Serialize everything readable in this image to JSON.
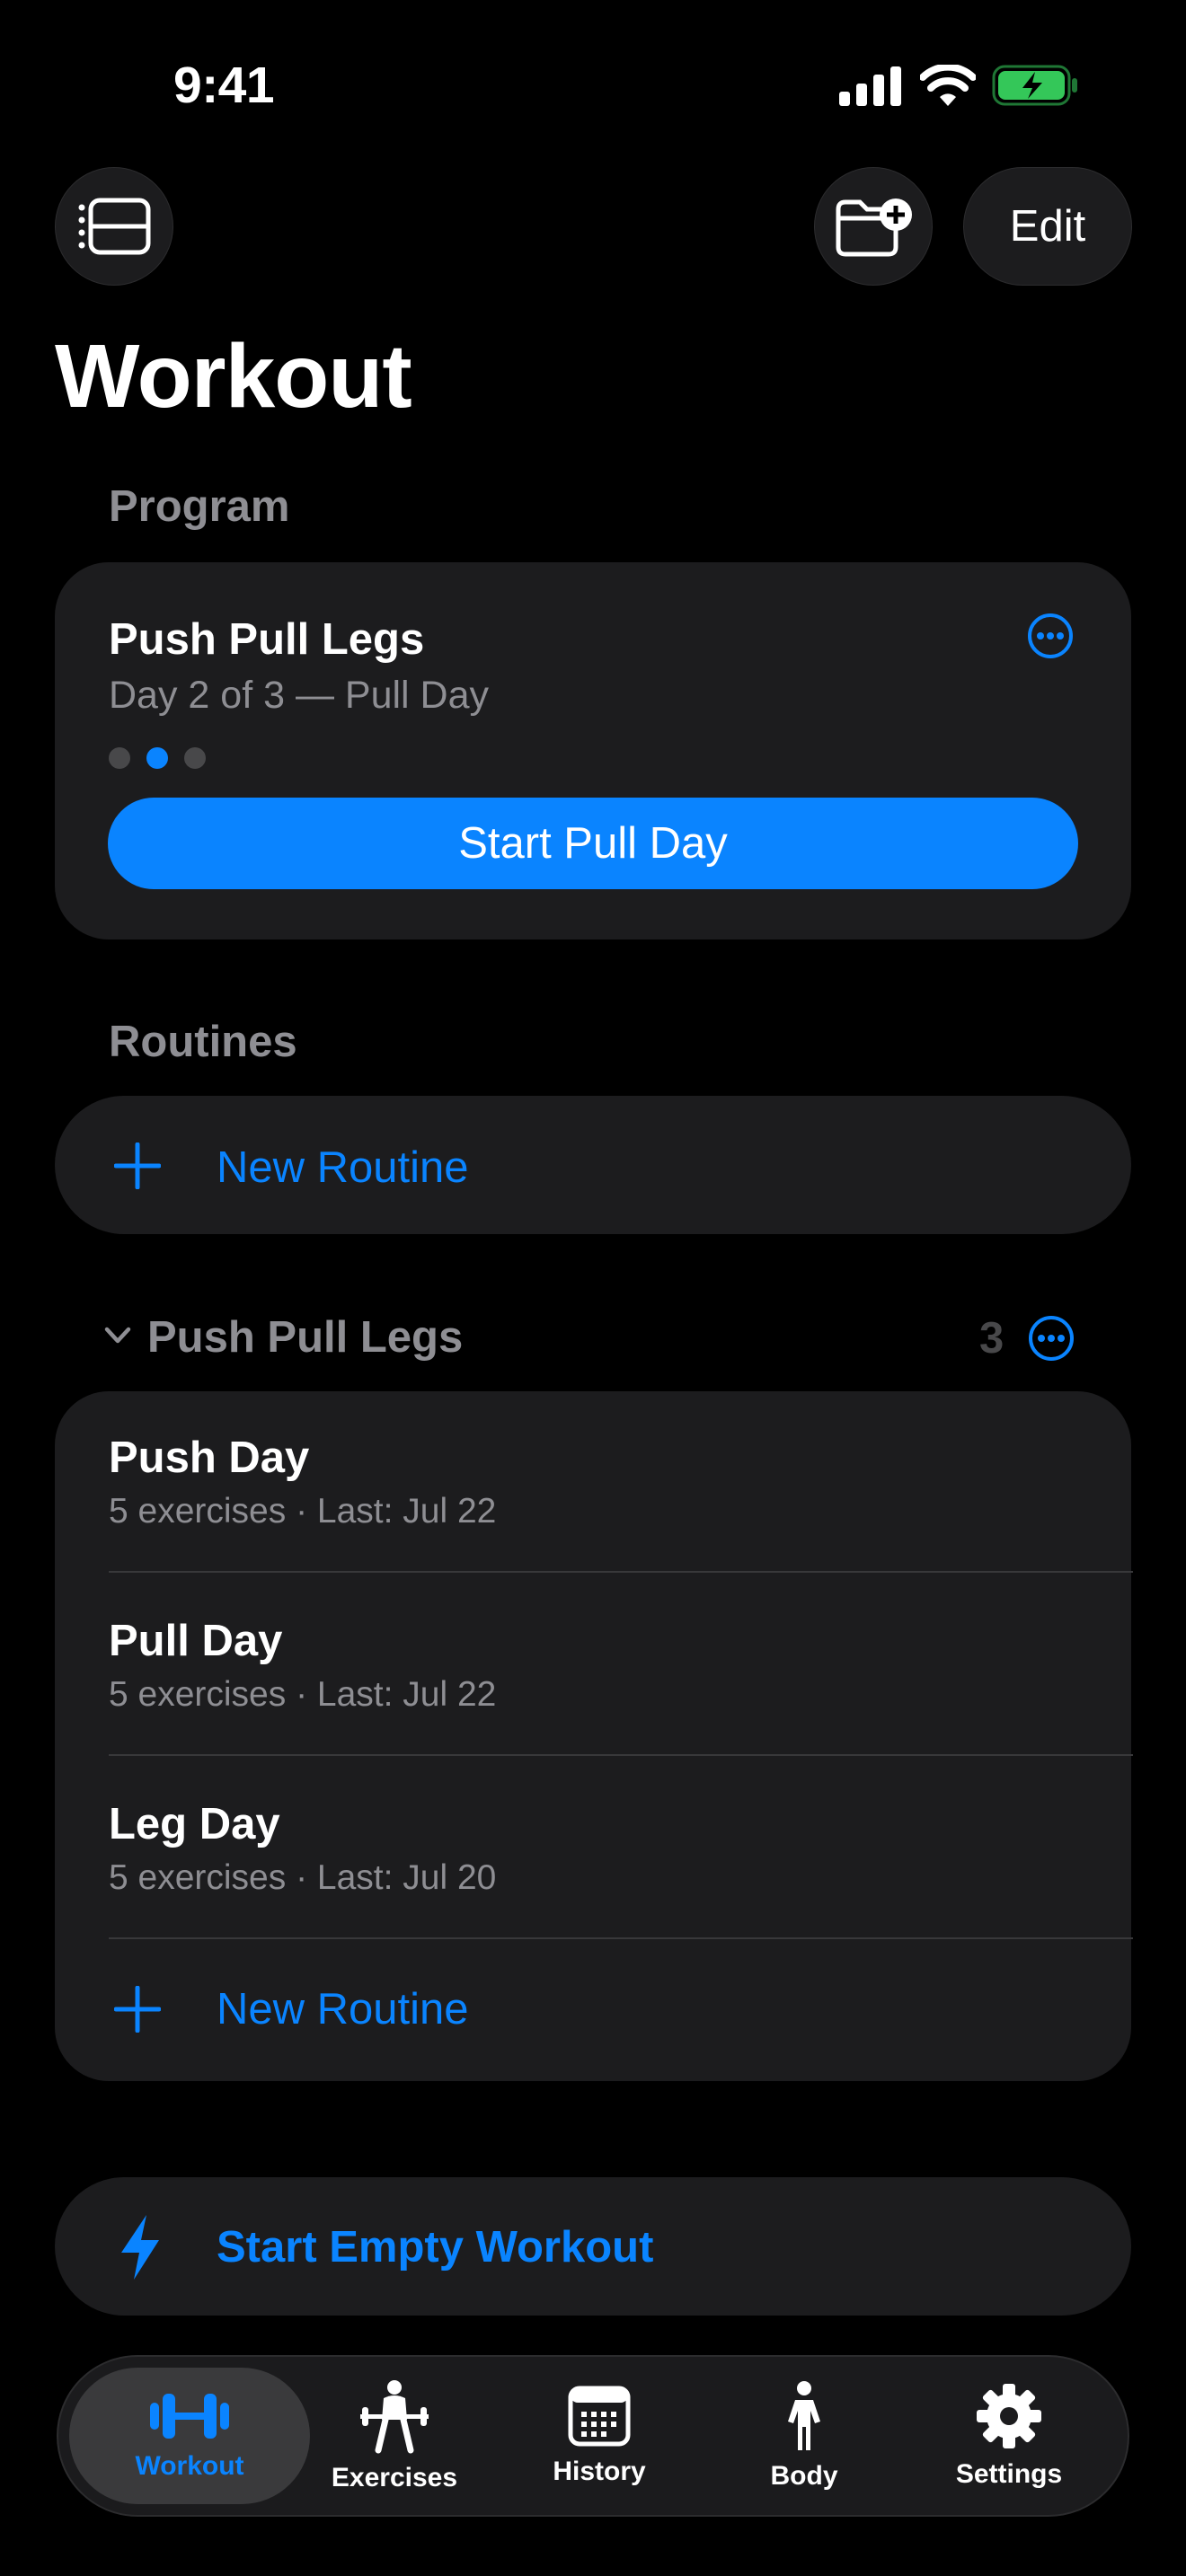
{
  "status_bar": {
    "time": "9:41"
  },
  "header": {
    "edit_label": "Edit",
    "title": "Workout"
  },
  "program": {
    "section_label": "Program",
    "name": "Push Pull Legs",
    "progress_text": "Day 2 of 3 — Pull Day",
    "current_day": 2,
    "total_days": 3,
    "start_button_label": "Start Pull Day"
  },
  "routines": {
    "section_label": "Routines",
    "new_routine_label": "New Routine",
    "folder": {
      "name": "Push Pull Legs",
      "count": "3",
      "items": [
        {
          "title": "Push Day",
          "subtitle": "5 exercises · Last: Jul 22"
        },
        {
          "title": "Pull Day",
          "subtitle": "5 exercises · Last: Jul 22"
        },
        {
          "title": "Leg Day",
          "subtitle": "5 exercises · Last: Jul 20"
        }
      ],
      "new_routine_label": "New Routine"
    }
  },
  "empty_workout": {
    "label": "Start Empty Workout"
  },
  "tabbar": {
    "tabs": [
      {
        "label": "Workout",
        "icon": "dumbbell-icon",
        "active": true
      },
      {
        "label": "Exercises",
        "icon": "weightlifter-icon",
        "active": false
      },
      {
        "label": "History",
        "icon": "calendar-icon",
        "active": false
      },
      {
        "label": "Body",
        "icon": "person-icon",
        "active": false
      },
      {
        "label": "Settings",
        "icon": "gear-icon",
        "active": false
      }
    ]
  },
  "colors": {
    "accent": "#0a84ff",
    "background": "#000000",
    "card": "#1c1c1e",
    "secondary_text": "#8e8e93",
    "battery": "#34c759"
  }
}
